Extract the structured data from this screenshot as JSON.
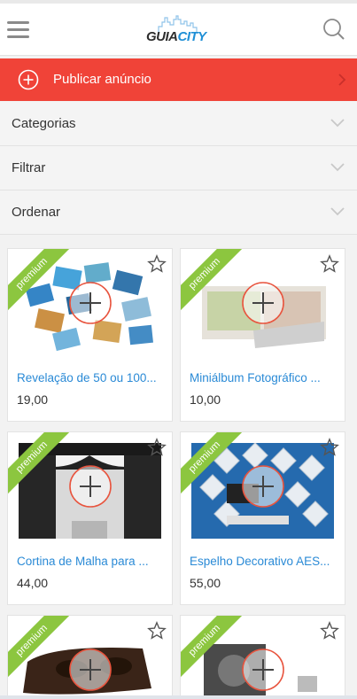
{
  "header": {
    "logo_part1": "GUIA",
    "logo_part2": "CITY",
    "menu_icon": "hamburger-icon",
    "search_icon": "search-icon"
  },
  "publish": {
    "label": "Publicar anúncio",
    "color": "#f04338"
  },
  "filters": {
    "categories": "Categorias",
    "filter": "Filtrar",
    "order": "Ordenar"
  },
  "badge_color": "#8cc63f",
  "link_color": "#2a8ad6",
  "products": [
    {
      "badge": "premium",
      "title": "Revelação de 50 ou 100...",
      "price": "19,00"
    },
    {
      "badge": "premium",
      "title": "Miniálbum Fotográfico ...",
      "price": "10,00"
    },
    {
      "badge": "premium",
      "title": "Cortina de Malha para ...",
      "price": "44,00"
    },
    {
      "badge": "premium",
      "title": "Espelho Decorativo AES...",
      "price": "55,00"
    },
    {
      "badge": "premium",
      "title": "",
      "price": ""
    },
    {
      "badge": "premium",
      "title": "",
      "price": ""
    }
  ]
}
